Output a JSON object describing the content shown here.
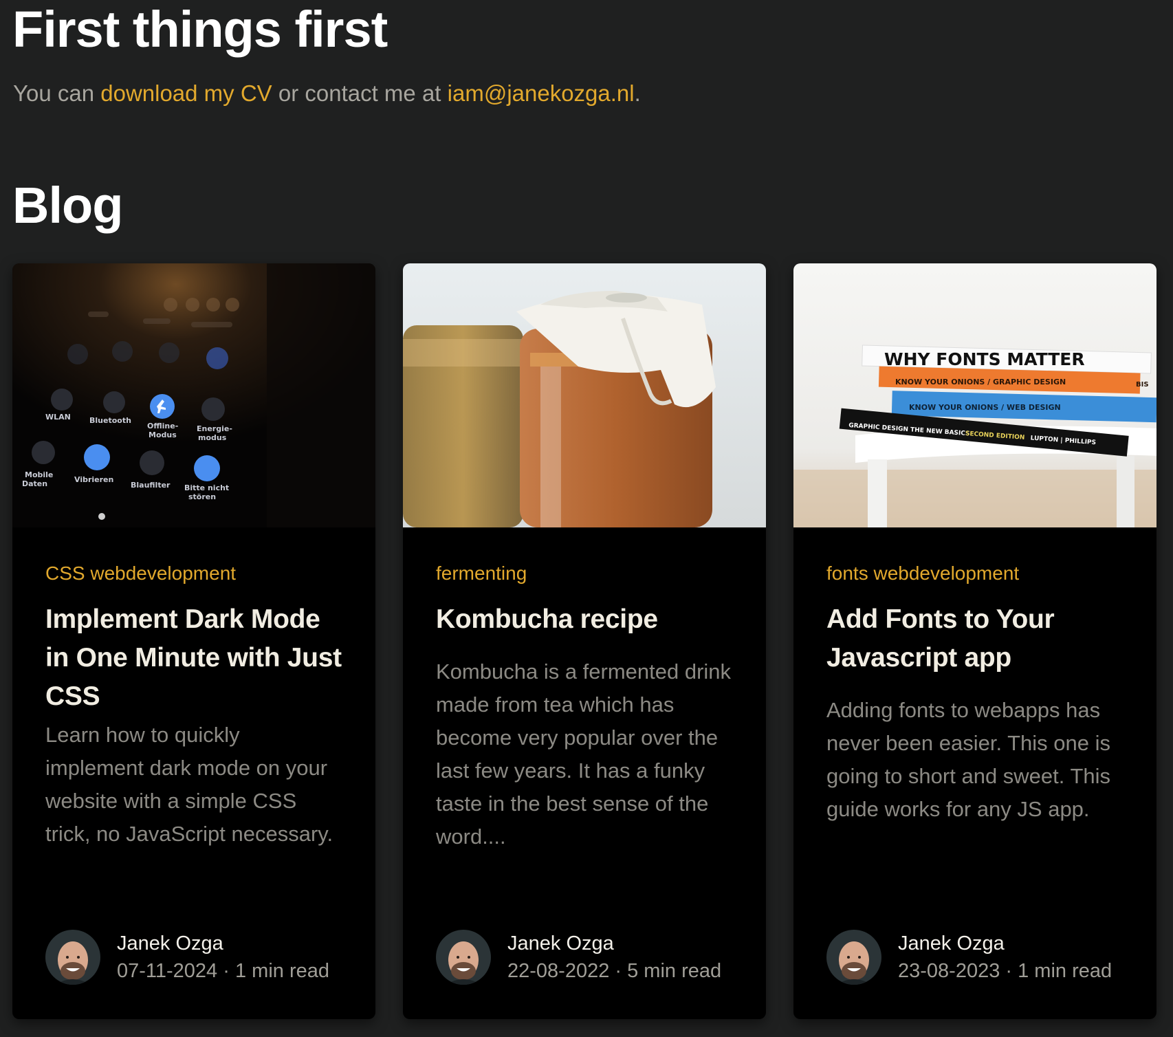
{
  "header": {
    "title": "First things first",
    "intro_prefix": "You can ",
    "cv_link": "download my CV",
    "intro_middle": " or contact me at ",
    "email_link": "iam@janekozga.nl",
    "intro_suffix": "."
  },
  "blog": {
    "title": "Blog",
    "posts": [
      {
        "tags": "CSS webdevelopment",
        "title": "Implement Dark Mode in One Minute with Just CSS",
        "excerpt": "Learn how to quickly implement dark mode on your website with a simple CSS trick, no JavaScript necessary.",
        "author": "Janek Ozga",
        "date": "07-11-2024",
        "read_time": "1 min read",
        "thumb_labels": [
          "WLAN",
          "Bluetooth",
          "Offline-",
          "Modus",
          "Energie-",
          "modus",
          "Mobile",
          "Daten",
          "Vibrieren",
          "Blaufilter",
          "Bitte nicht",
          "stören"
        ]
      },
      {
        "tags": "fermenting",
        "title": "Kombucha recipe",
        "excerpt": "Kombucha is a fermented drink made from tea which has become very popular over the last few years. It has a funky taste in the best sense of the word....",
        "author": "Janek Ozga",
        "date": "22-08-2022",
        "read_time": "5 min read"
      },
      {
        "tags": "fonts webdevelopment",
        "title": "Add Fonts to Your Javascript app",
        "excerpt": "Adding fonts to webapps has never been easier. This one is going to short and sweet. This guide works for any JS app.",
        "author": "Janek Ozga",
        "date": "23-08-2023",
        "read_time": "1 min read",
        "thumb_labels": [
          "WHY FONTS MATTER",
          "KNOW YOUR ONIONS / GRAPHIC DESIGN",
          "KNOW YOUR ONIONS / WEB DESIGN",
          "GRAPHIC DESIGN THE NEW BASICS",
          "SECOND EDITION",
          "LUPTON | PHILLIPS",
          "BIS"
        ]
      }
    ],
    "meta_separator": " · "
  },
  "colors": {
    "background": "#1f2020",
    "card": "#000000",
    "accent": "#e2a92d",
    "heading": "#ffffff",
    "muted": "#8c8a84"
  }
}
